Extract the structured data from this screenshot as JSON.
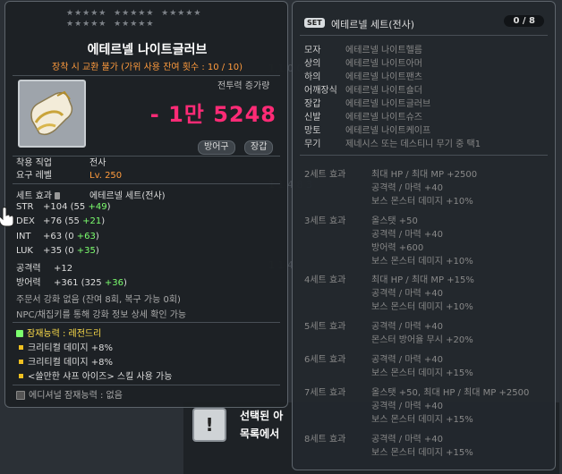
{
  "item": {
    "name": "에테르넬 나이트글러브",
    "trade_note": "장착 시 교환 불가 (가위 사용 잔여 횟수 : 10 / 10)",
    "cp_label": "전투력 증가량",
    "cp_value": "- 1만 5248",
    "tags": [
      "방어구",
      "장갑"
    ],
    "job_label": "착용 직업",
    "job_value": "전사",
    "level_label": "요구 레벨",
    "level_value": "Lv. 250",
    "set_label": "세트 효과",
    "set_value": "에테르넬 세트(전사)",
    "stats": [
      {
        "name": "STR",
        "total": "+104",
        "detail": "(55 ",
        "bonus": "+49",
        "end": ")"
      },
      {
        "name": "DEX",
        "total": "+76",
        "detail": "(55 ",
        "bonus": "+21",
        "end": ")"
      },
      {
        "name": "INT",
        "total": "+63",
        "detail": "(0 ",
        "bonus": "+63",
        "end": ")"
      },
      {
        "name": "LUK",
        "total": "+35",
        "detail": "(0 ",
        "bonus": "+35",
        "end": ")"
      },
      {
        "name": "공격력",
        "total": "+12",
        "detail": "",
        "bonus": "",
        "end": ""
      },
      {
        "name": "방어력",
        "total": "+361",
        "detail": "(325 ",
        "bonus": "+36",
        "end": ")"
      }
    ],
    "enhance_note": "주문서 강화 없음 (잔여 8회, 복구 가능 0회)",
    "npc_note": "NPC/채집키를 통해 강화 정보 상세 확인 가능",
    "potential_title": "잠재능력 : 레전드리",
    "potential_lines": [
      "크리티컬 데미지 +8%",
      "크리티컬 데미지 +8%",
      "<쓸만한 샤프 아이즈> 스킬 사용 가능"
    ],
    "additional_potential": "에디셔널 잠재능력 : 없음"
  },
  "set_panel": {
    "badge": "SET",
    "title": "에테르넬 세트(전사)",
    "count": "0 / 8",
    "parts": [
      {
        "label": "모자",
        "value": "에테르넬 나이트헬름"
      },
      {
        "label": "상의",
        "value": "에테르넬 나이트아머"
      },
      {
        "label": "하의",
        "value": "에테르넬 나이트팬츠"
      },
      {
        "label": "어깨장식",
        "value": "에테르넬 나이트숄더"
      },
      {
        "label": "장갑",
        "value": "에테르넬 나이트글러브"
      },
      {
        "label": "신발",
        "value": "에테르넬 나이트슈즈"
      },
      {
        "label": "망토",
        "value": "에테르넬 나이트케이프"
      },
      {
        "label": "무기",
        "value": "제네시스 또는 데스티니 무기 중 택1"
      }
    ],
    "effects": [
      {
        "head": "2세트 효과",
        "lines": [
          "최대 HP / 최대 MP  +2500",
          "공격력 / 마력  +40",
          "보스 몬스터 데미지 +10%"
        ]
      },
      {
        "head": "3세트 효과",
        "lines": [
          "올스탯  +50",
          "공격력 / 마력  +40",
          "방어력  +600",
          "보스 몬스터 데미지 +10%"
        ]
      },
      {
        "head": "4세트 효과",
        "lines": [
          "최대 HP / 최대 MP  +15%",
          "공격력 / 마력  +40",
          "보스 몬스터 데미지 +10%"
        ]
      },
      {
        "head": "5세트 효과",
        "lines": [
          "공격력 / 마력  +40",
          "몬스터 방어율 무시 +20%"
        ]
      },
      {
        "head": "6세트 효과",
        "lines": [
          "공격력 / 마력  +40",
          "보스 몬스터 데미지 +15%"
        ]
      },
      {
        "head": "7세트 효과",
        "lines": [
          "올스탯  +50, 최대 HP / 최대 MP  +2500",
          "공격력 / 마력  +40",
          "보스 몬스터 데미지 +15%"
        ]
      },
      {
        "head": "8세트 효과",
        "lines": [
          "공격력 / 마력  +40",
          "보스 몬스터 데미지 +15%"
        ]
      }
    ]
  },
  "notice": {
    "icon": "!",
    "line1": "선택된 아",
    "line2": "목록에서"
  }
}
